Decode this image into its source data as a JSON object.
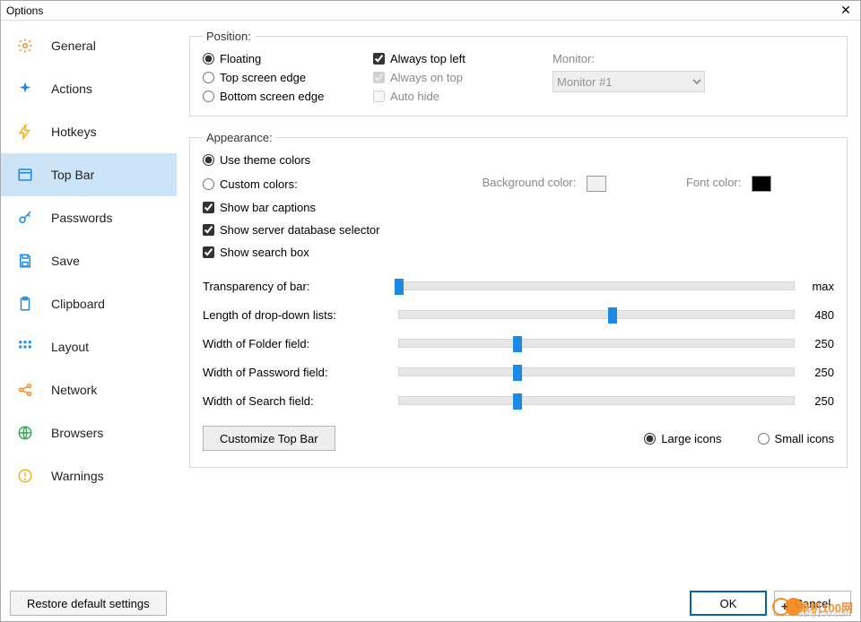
{
  "window": {
    "title": "Options"
  },
  "sidebar": {
    "items": [
      {
        "label": "General",
        "icon": "gear-icon",
        "color": "#f58a1f"
      },
      {
        "label": "Actions",
        "icon": "sparkle-icon",
        "color": "#1e88e5"
      },
      {
        "label": "Hotkeys",
        "icon": "bolt-icon",
        "color": "#f3b11c"
      },
      {
        "label": "Top Bar",
        "icon": "topbar-icon",
        "color": "#1e88e5"
      },
      {
        "label": "Passwords",
        "icon": "key-icon",
        "color": "#1e88e5"
      },
      {
        "label": "Save",
        "icon": "save-icon",
        "color": "#1e88e5"
      },
      {
        "label": "Clipboard",
        "icon": "clipboard-icon",
        "color": "#1e88e5"
      },
      {
        "label": "Layout",
        "icon": "grid-icon",
        "color": "#1e88e5"
      },
      {
        "label": "Network",
        "icon": "share-icon",
        "color": "#f58a1f"
      },
      {
        "label": "Browsers",
        "icon": "globe-icon",
        "color": "#3aa757"
      },
      {
        "label": "Warnings",
        "icon": "warning-icon",
        "color": "#f3b11c"
      }
    ],
    "selected_index": 3
  },
  "position": {
    "legend": "Position:",
    "mode": "floating",
    "options": {
      "floating": "Floating",
      "top_edge": "Top screen edge",
      "bottom_edge": "Bottom screen edge"
    },
    "always_top_left": {
      "label": "Always top left",
      "checked": true,
      "enabled": true
    },
    "always_on_top": {
      "label": "Always on top",
      "checked": true,
      "enabled": false
    },
    "auto_hide": {
      "label": "Auto hide",
      "checked": false,
      "enabled": false
    },
    "monitor_label": "Monitor:",
    "monitor_value": "Monitor #1",
    "monitor_enabled": false
  },
  "appearance": {
    "legend": "Appearance:",
    "color_mode": "theme",
    "use_theme_label": "Use theme colors",
    "custom_label": "Custom colors:",
    "bg_label": "Background color:",
    "bg_color": "#f1f1f1",
    "font_label": "Font color:",
    "font_color": "#000000",
    "show_captions": {
      "label": "Show bar captions",
      "checked": true
    },
    "show_db_sel": {
      "label": "Show server database selector",
      "checked": true
    },
    "show_search": {
      "label": "Show search box",
      "checked": true
    },
    "sliders": [
      {
        "label": "Transparency of bar:",
        "value_text": "max",
        "percent": 0
      },
      {
        "label": "Length of drop-down lists:",
        "value_text": "480",
        "percent": 54
      },
      {
        "label": "Width of Folder field:",
        "value_text": "250",
        "percent": 30
      },
      {
        "label": "Width of Password field:",
        "value_text": "250",
        "percent": 30
      },
      {
        "label": "Width of Search field:",
        "value_text": "250",
        "percent": 30
      }
    ],
    "customize_btn": "Customize Top Bar",
    "icon_size_mode": "large",
    "large_icons_label": "Large icons",
    "small_icons_label": "Small icons"
  },
  "footer": {
    "restore": "Restore default settings",
    "ok": "OK",
    "cancel": "Cancel"
  },
  "watermark": {
    "brand": "单机100网",
    "url": "danji100.com"
  }
}
